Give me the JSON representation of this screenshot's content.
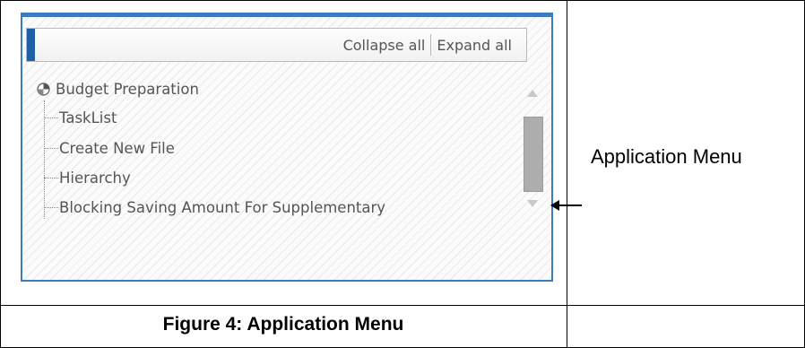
{
  "toolbar": {
    "collapse_label": "Collapse all",
    "expand_label": "Expand all"
  },
  "tree": {
    "root_label": "Budget Preparation",
    "items": [
      {
        "label": "TaskList"
      },
      {
        "label": "Create New File"
      },
      {
        "label": "Hierarchy"
      },
      {
        "label": "Blocking Saving Amount For Supplementary"
      }
    ]
  },
  "callout": {
    "label": "Application Menu"
  },
  "caption": {
    "text": "Figure 4: Application Menu"
  },
  "colors": {
    "panel_border": "#3b7bc0",
    "toolbar_accent": "#1f5fa5",
    "menu_text": "#555555"
  },
  "icons": [
    "budget-preparation-icon",
    "scroll-up-icon",
    "scroll-down-icon",
    "callout-arrow-icon"
  ]
}
